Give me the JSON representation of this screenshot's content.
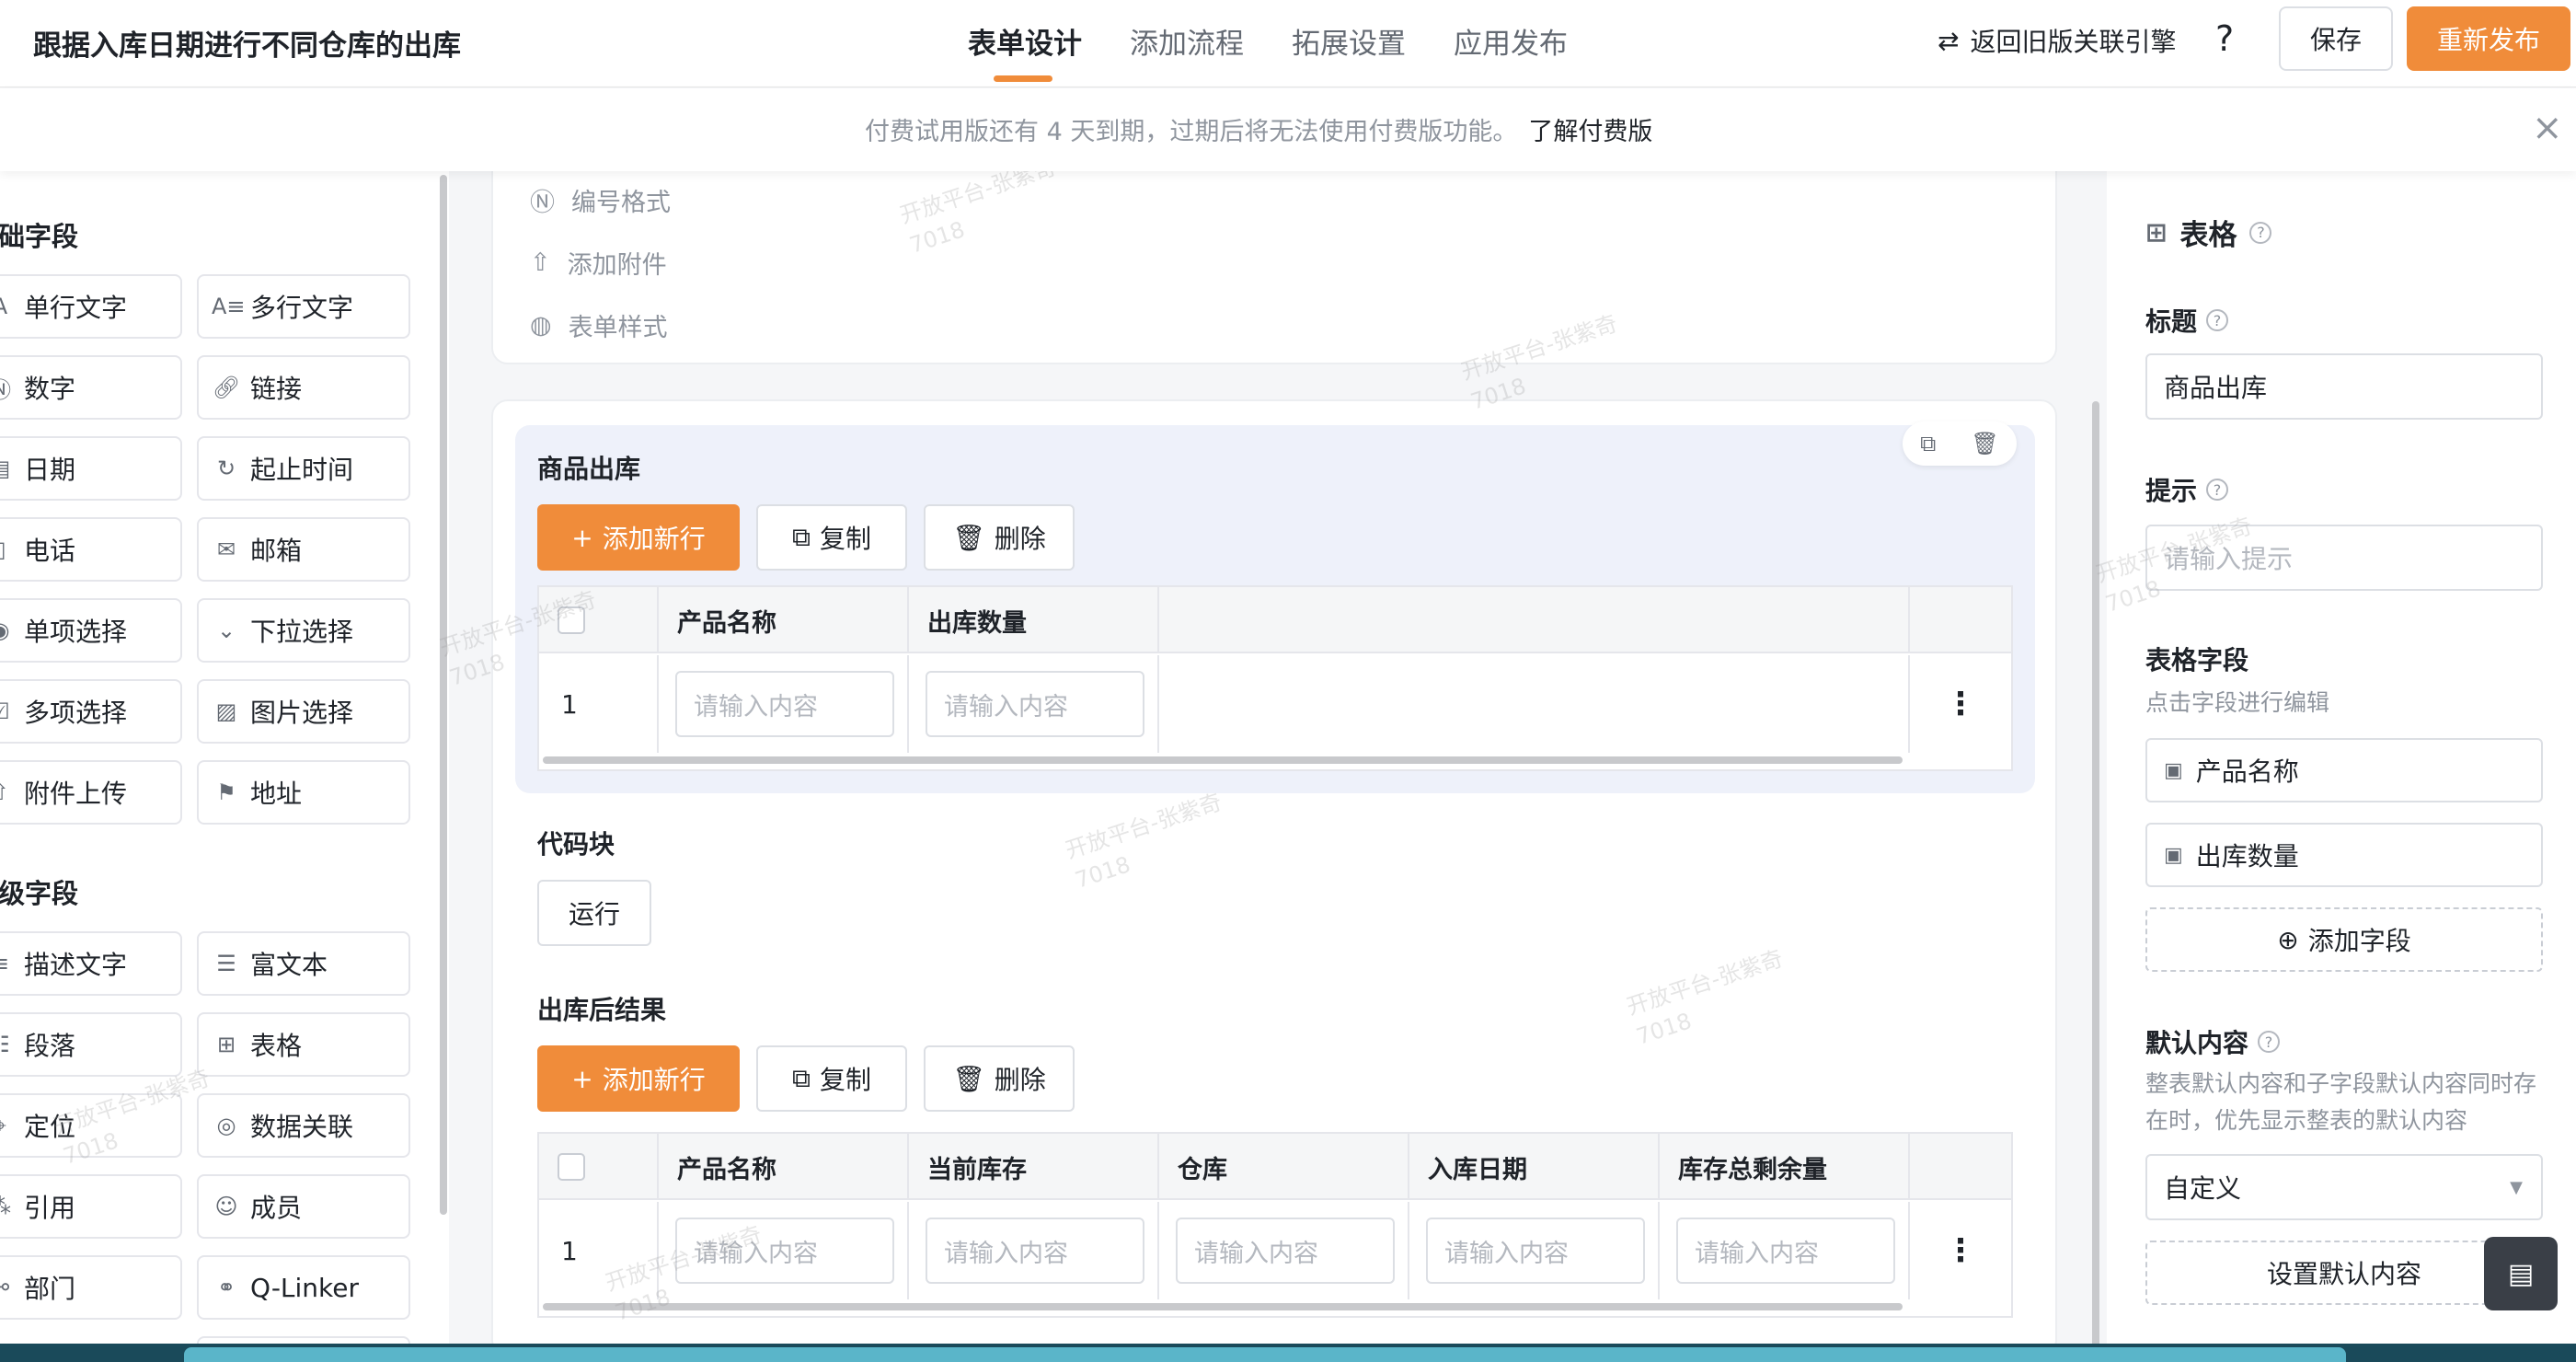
{
  "header": {
    "title": "跟据入库日期进行不同仓库的出库",
    "tabs": [
      {
        "label": "表单设计",
        "active": true
      },
      {
        "label": "添加流程",
        "active": false
      },
      {
        "label": "拓展设置",
        "active": false
      },
      {
        "label": "应用发布",
        "active": false
      }
    ],
    "legacy_link": "返回旧版关联引擎",
    "help": "?",
    "save": "保存",
    "publish": "重新发布",
    "accent_color": "#f08c3a"
  },
  "notice": {
    "text": "付费试用版还有 4 天到期，过期后将无法使用付费版功能。",
    "link": "了解付费版",
    "close": "×"
  },
  "left_panel": {
    "basic_title": "础字段",
    "basic_fields": [
      {
        "label": "单行文字",
        "icon": "text-icon"
      },
      {
        "label": "多行文字",
        "icon": "multiline-text-icon"
      },
      {
        "label": "数字",
        "icon": "number-icon"
      },
      {
        "label": "链接",
        "icon": "link-icon"
      },
      {
        "label": "日期",
        "icon": "date-icon"
      },
      {
        "label": "起止时间",
        "icon": "time-range-icon"
      },
      {
        "label": "电话",
        "icon": "phone-icon"
      },
      {
        "label": "邮箱",
        "icon": "mail-icon"
      },
      {
        "label": "单项选择",
        "icon": "radio-icon"
      },
      {
        "label": "下拉选择",
        "icon": "dropdown-icon"
      },
      {
        "label": "多项选择",
        "icon": "checkbox-icon"
      },
      {
        "label": "图片选择",
        "icon": "image-icon"
      },
      {
        "label": "附件上传",
        "icon": "upload-icon"
      },
      {
        "label": "地址",
        "icon": "address-icon"
      }
    ],
    "advanced_title": "级字段",
    "advanced_fields": [
      {
        "label": "描述文字",
        "icon": "description-icon"
      },
      {
        "label": "富文本",
        "icon": "rich-text-icon"
      },
      {
        "label": "段落",
        "icon": "paragraph-icon"
      },
      {
        "label": "表格",
        "icon": "table-icon"
      },
      {
        "label": "定位",
        "icon": "location-icon"
      },
      {
        "label": "数据关联",
        "icon": "data-link-icon"
      },
      {
        "label": "引用",
        "icon": "reference-icon"
      },
      {
        "label": "成员",
        "icon": "member-icon"
      },
      {
        "label": "部门",
        "icon": "department-icon"
      },
      {
        "label": "Q-Linker",
        "icon": "qlinker-icon"
      }
    ]
  },
  "canvas": {
    "settings": [
      "编号格式",
      "添加附件",
      "表单样式"
    ],
    "table1": {
      "title": "商品出库",
      "add_row": "添加新行",
      "copy": "复制",
      "delete": "删除",
      "columns": [
        "产品名称",
        "出库数量"
      ],
      "row_number": "1",
      "placeholder": "请输入内容"
    },
    "code_block": {
      "title": "代码块",
      "run": "运行"
    },
    "table2": {
      "title": "出库后结果",
      "add_row": "添加新行",
      "copy": "复制",
      "delete": "删除",
      "columns": [
        "产品名称",
        "当前库存",
        "仓库",
        "入库日期",
        "库存总剩余量"
      ],
      "row_number": "1",
      "placeholder": "请输入内容"
    }
  },
  "right_panel": {
    "header": "表格",
    "title_label": "标题",
    "title_value": "商品出库",
    "hint_label": "提示",
    "hint_placeholder": "请输入提示",
    "fields_label": "表格字段",
    "fields_sub": "点击字段进行编辑",
    "fields": [
      "产品名称",
      "出库数量"
    ],
    "add_field": "添加字段",
    "default_label": "默认内容",
    "default_sub": "整表默认内容和子字段默认内容同时存在时，优先显示整表的默认内容",
    "default_select": "自定义",
    "set_default": "设置默认内容"
  },
  "watermark": {
    "line1": "开放平台-张紫奇",
    "line2": "7018"
  }
}
